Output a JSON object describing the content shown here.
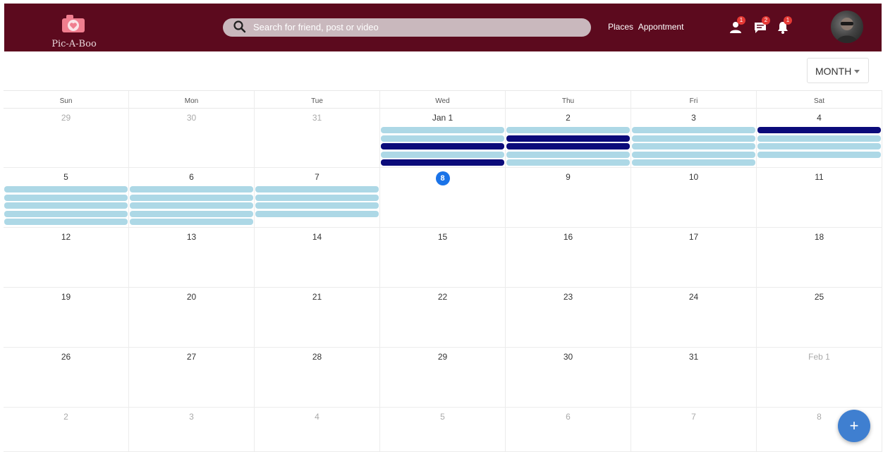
{
  "brand": {
    "name": "Pic-A-Boo",
    "logo_icon": "camera-heart-icon",
    "logo_color": "#f07e8f"
  },
  "header": {
    "bg_color": "#5c0a1e",
    "search_placeholder": "Search for friend, post or video",
    "links": [
      "Places",
      "Appontment"
    ],
    "notifications": [
      {
        "icon": "friend-request-icon",
        "count": "1"
      },
      {
        "icon": "message-icon",
        "count": "2"
      },
      {
        "icon": "bell-icon",
        "count": "1"
      }
    ]
  },
  "view_selector": {
    "label": "MONTH",
    "icon": "caret-down-icon"
  },
  "calendar": {
    "weekdays": [
      "Sun",
      "Mon",
      "Tue",
      "Wed",
      "Thu",
      "Fri",
      "Sat"
    ],
    "event_colors": {
      "light": "#add8e6",
      "dark": "#0b0b7a"
    },
    "today_color": "#1a73e8",
    "weeks": [
      [
        {
          "label": "29",
          "other": true,
          "events": []
        },
        {
          "label": "30",
          "other": true,
          "events": []
        },
        {
          "label": "31",
          "other": true,
          "events": []
        },
        {
          "label": "Jan 1",
          "other": false,
          "events": [
            "light",
            "light",
            "dark",
            "light",
            "dark"
          ]
        },
        {
          "label": "2",
          "other": false,
          "events": [
            "light",
            "dark",
            "dark",
            "light",
            "light"
          ]
        },
        {
          "label": "3",
          "other": false,
          "events": [
            "light",
            "light",
            "light",
            "light",
            "light"
          ]
        },
        {
          "label": "4",
          "other": false,
          "events": [
            "dark",
            "light",
            "light",
            "light"
          ]
        }
      ],
      [
        {
          "label": "5",
          "other": false,
          "events": [
            "light",
            "light",
            "light",
            "light",
            "light"
          ]
        },
        {
          "label": "6",
          "other": false,
          "events": [
            "light",
            "light",
            "light",
            "light",
            "light"
          ]
        },
        {
          "label": "7",
          "other": false,
          "events": [
            "light",
            "light",
            "light",
            "light"
          ]
        },
        {
          "label": "8",
          "other": false,
          "today": true,
          "events": []
        },
        {
          "label": "9",
          "other": false,
          "events": []
        },
        {
          "label": "10",
          "other": false,
          "events": []
        },
        {
          "label": "11",
          "other": false,
          "events": []
        }
      ],
      [
        {
          "label": "12",
          "events": []
        },
        {
          "label": "13",
          "events": []
        },
        {
          "label": "14",
          "events": []
        },
        {
          "label": "15",
          "events": []
        },
        {
          "label": "16",
          "events": []
        },
        {
          "label": "17",
          "events": []
        },
        {
          "label": "18",
          "events": []
        }
      ],
      [
        {
          "label": "19",
          "events": []
        },
        {
          "label": "20",
          "events": []
        },
        {
          "label": "21",
          "events": []
        },
        {
          "label": "22",
          "events": []
        },
        {
          "label": "23",
          "events": []
        },
        {
          "label": "24",
          "events": []
        },
        {
          "label": "25",
          "events": []
        }
      ],
      [
        {
          "label": "26",
          "events": []
        },
        {
          "label": "27",
          "events": []
        },
        {
          "label": "28",
          "events": []
        },
        {
          "label": "29",
          "events": []
        },
        {
          "label": "30",
          "events": []
        },
        {
          "label": "31",
          "events": []
        },
        {
          "label": "Feb 1",
          "other": true,
          "events": []
        }
      ],
      [
        {
          "label": "2",
          "other": true,
          "events": []
        },
        {
          "label": "3",
          "other": true,
          "events": []
        },
        {
          "label": "4",
          "other": true,
          "events": []
        },
        {
          "label": "5",
          "other": true,
          "events": []
        },
        {
          "label": "6",
          "other": true,
          "events": []
        },
        {
          "label": "7",
          "other": true,
          "events": []
        },
        {
          "label": "8",
          "other": true,
          "events": []
        }
      ]
    ]
  },
  "fab": {
    "label": "+",
    "icon": "plus-icon"
  }
}
